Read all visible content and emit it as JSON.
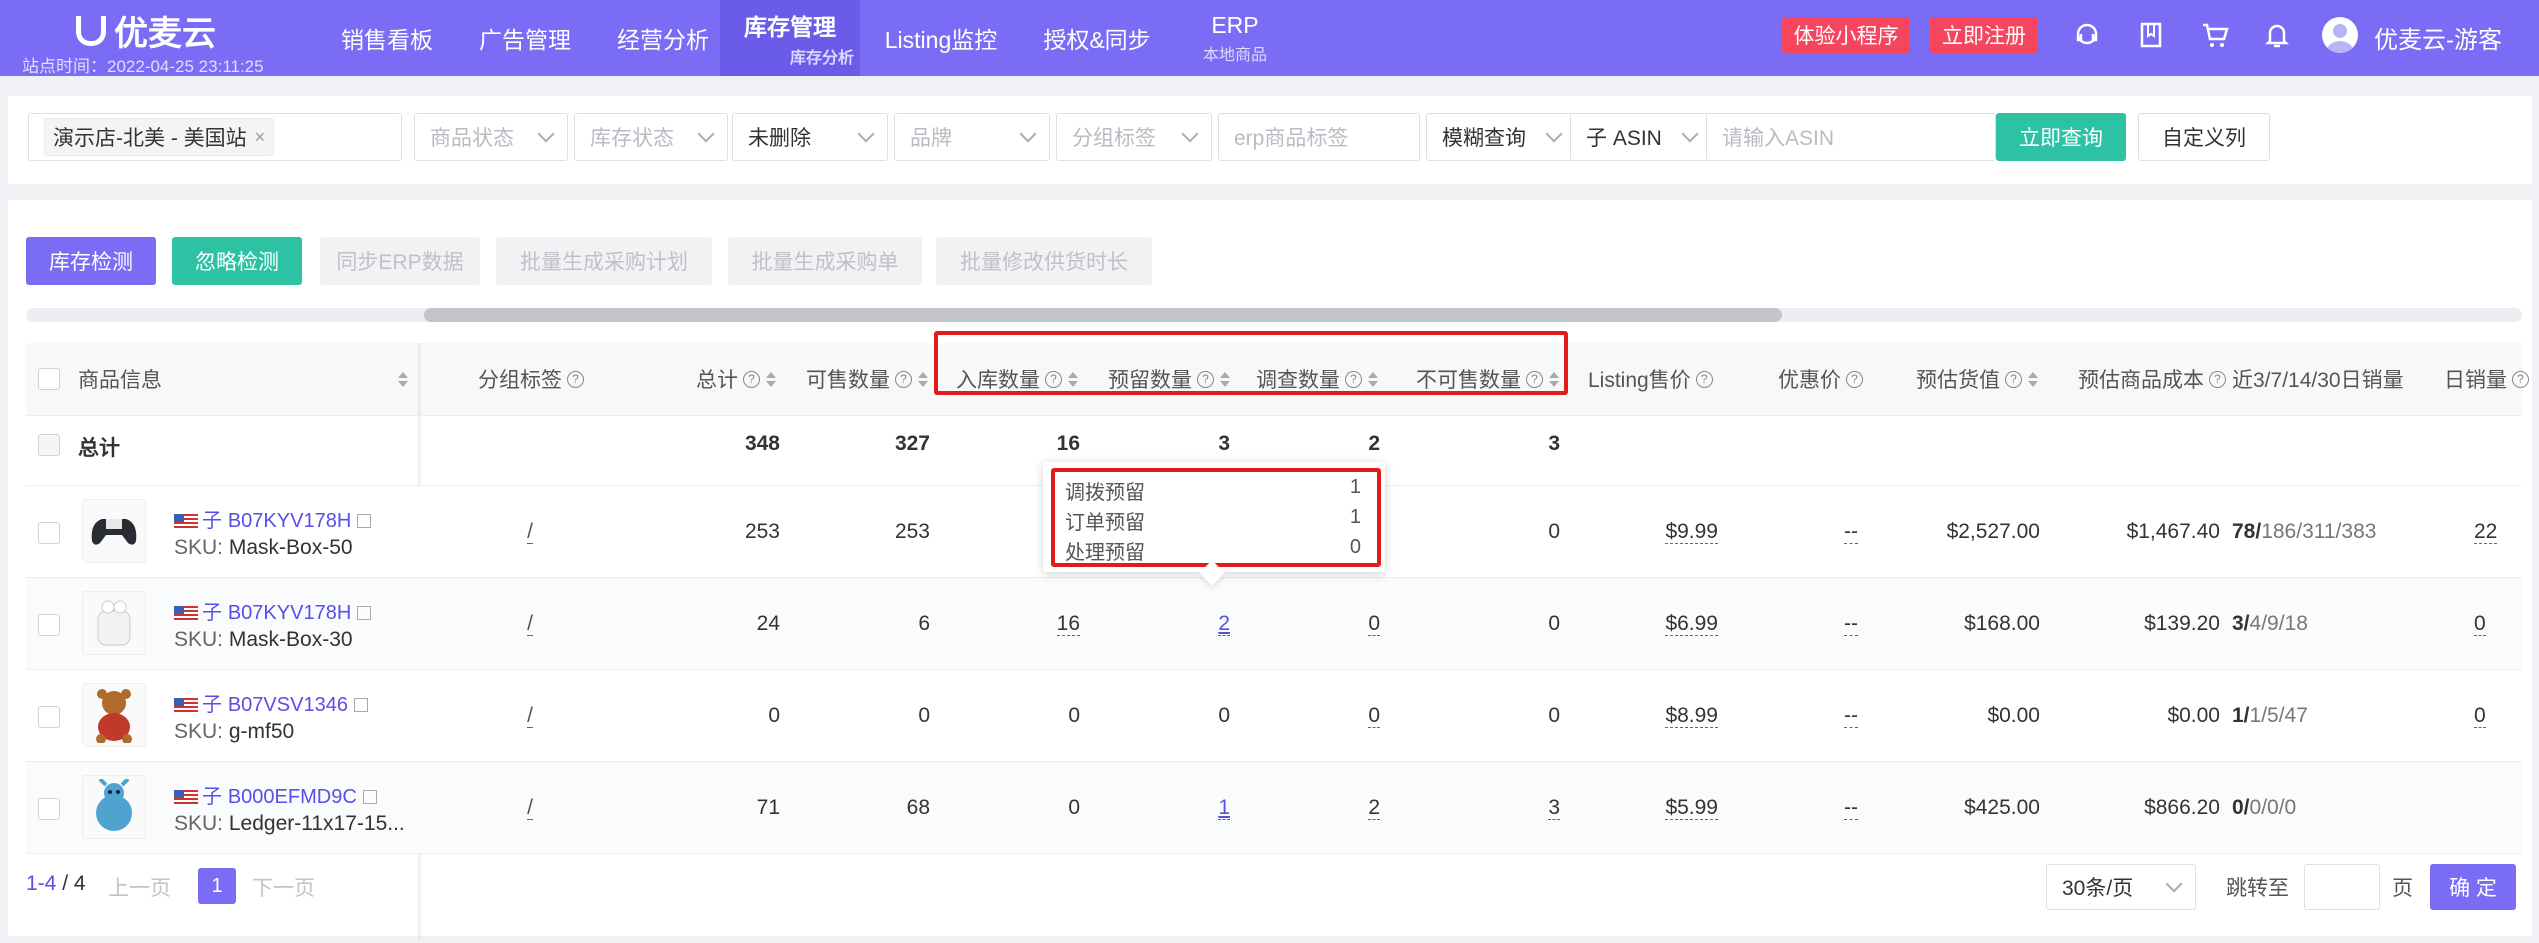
{
  "header": {
    "logo": "优麦云",
    "site_time": "站点时间：2022-04-25 23:11:25",
    "nav": [
      {
        "label": "销售看板",
        "sub": ""
      },
      {
        "label": "广告管理",
        "sub": ""
      },
      {
        "label": "经营分析",
        "sub": ""
      },
      {
        "label": "库存管理",
        "sub": "库存分析"
      },
      {
        "label": "Listing监控",
        "sub": ""
      },
      {
        "label": "授权&同步",
        "sub": ""
      },
      {
        "label": "ERP",
        "sub": "本地商品"
      }
    ],
    "btn_mini": "体验小程序",
    "btn_register": "立即注册",
    "user": "优麦云-游客"
  },
  "filters": {
    "store": "演示店-北美 - 美国站",
    "product_status": "商品状态",
    "stock_status": "库存状态",
    "deleted": "未删除",
    "brand": "品牌",
    "group_tag": "分组标签",
    "erp_tag": "erp商品标签",
    "fuzzy": "模糊查询",
    "asin_type": "子 ASIN",
    "asin_placeholder": "请输入ASIN",
    "query_btn": "立即查询",
    "custom_cols_btn": "自定义列"
  },
  "actions": {
    "stock_check": "库存检测",
    "ignore_check": "忽略检测",
    "sync_erp": "同步ERP数据",
    "batch_plan": "批量生成采购计划",
    "batch_order": "批量生成采购单",
    "batch_lead": "批量修改供货时长"
  },
  "columns": {
    "product": "商品信息",
    "group": "分组标签",
    "total": "总计",
    "sellable": "可售数量",
    "inbound": "入库数量",
    "reserved": "预留数量",
    "research": "调查数量",
    "unsellable": "不可售数量",
    "listing_price": "Listing售价",
    "deal_price": "优惠价",
    "est_value": "预估货值",
    "est_cost": "预估商品成本",
    "sales_range": "近3/7/14/30日销量",
    "daily": "日销量"
  },
  "summary": {
    "label": "总计",
    "total": "348",
    "sellable": "327",
    "inbound": "16",
    "reserved": "3",
    "research": "2",
    "unsellable": "3"
  },
  "rows": [
    {
      "asin_prefix": "子",
      "asin": "B07KYV178H",
      "sku_label": "SKU:",
      "sku": "Mask-Box-50",
      "group": "/",
      "total": "253",
      "sellable": "253",
      "inbound": "",
      "reserved": "",
      "research": "",
      "unsellable": "0",
      "price": "$9.99",
      "deal": "--",
      "value": "$2,527.00",
      "cost": "$1,467.40",
      "s3": "78/",
      "s_rest": "186/311/383",
      "daily": "22"
    },
    {
      "asin_prefix": "子",
      "asin": "B07KYV178H",
      "sku_label": "SKU:",
      "sku": "Mask-Box-30",
      "group": "/",
      "total": "24",
      "sellable": "6",
      "inbound": "16",
      "reserved": "2",
      "research": "0",
      "unsellable": "0",
      "price": "$6.99",
      "deal": "--",
      "value": "$168.00",
      "cost": "$139.20",
      "s3": "3/",
      "s_rest": "4/9/18",
      "daily": "0"
    },
    {
      "asin_prefix": "子",
      "asin": "B07VSV1346",
      "sku_label": "SKU:",
      "sku": "g-mf50",
      "group": "/",
      "total": "0",
      "sellable": "0",
      "inbound": "0",
      "reserved": "0",
      "research": "0",
      "unsellable": "0",
      "price": "$8.99",
      "deal": "--",
      "value": "$0.00",
      "cost": "$0.00",
      "s3": "1/",
      "s_rest": "1/5/47",
      "daily": "0"
    },
    {
      "asin_prefix": "子",
      "asin": "B000EFMD9C",
      "sku_label": "SKU:",
      "sku": "Ledger-11x17-15...",
      "group": "/",
      "total": "71",
      "sellable": "68",
      "inbound": "0",
      "reserved": "1",
      "research": "2",
      "unsellable": "3",
      "price": "$5.99",
      "deal": "--",
      "value": "$425.00",
      "cost": "$866.20",
      "s3": "0/",
      "s_rest": "0/0/0",
      "daily": ""
    }
  ],
  "tooltip": [
    {
      "label": "调拨预留",
      "value": "1"
    },
    {
      "label": "订单预留",
      "value": "1"
    },
    {
      "label": "处理预留",
      "value": "0"
    }
  ],
  "pagination": {
    "range": "1-4",
    "total": "/ 4",
    "prev": "上一页",
    "current": "1",
    "next": "下一页",
    "page_size": "30条/页",
    "jump_label": "跳转至",
    "page_unit": "页",
    "confirm": "确 定"
  },
  "colors": {
    "brand": "#7a6cf5",
    "teal": "#2ec2a4",
    "highlight_red": "#e21b1b"
  }
}
